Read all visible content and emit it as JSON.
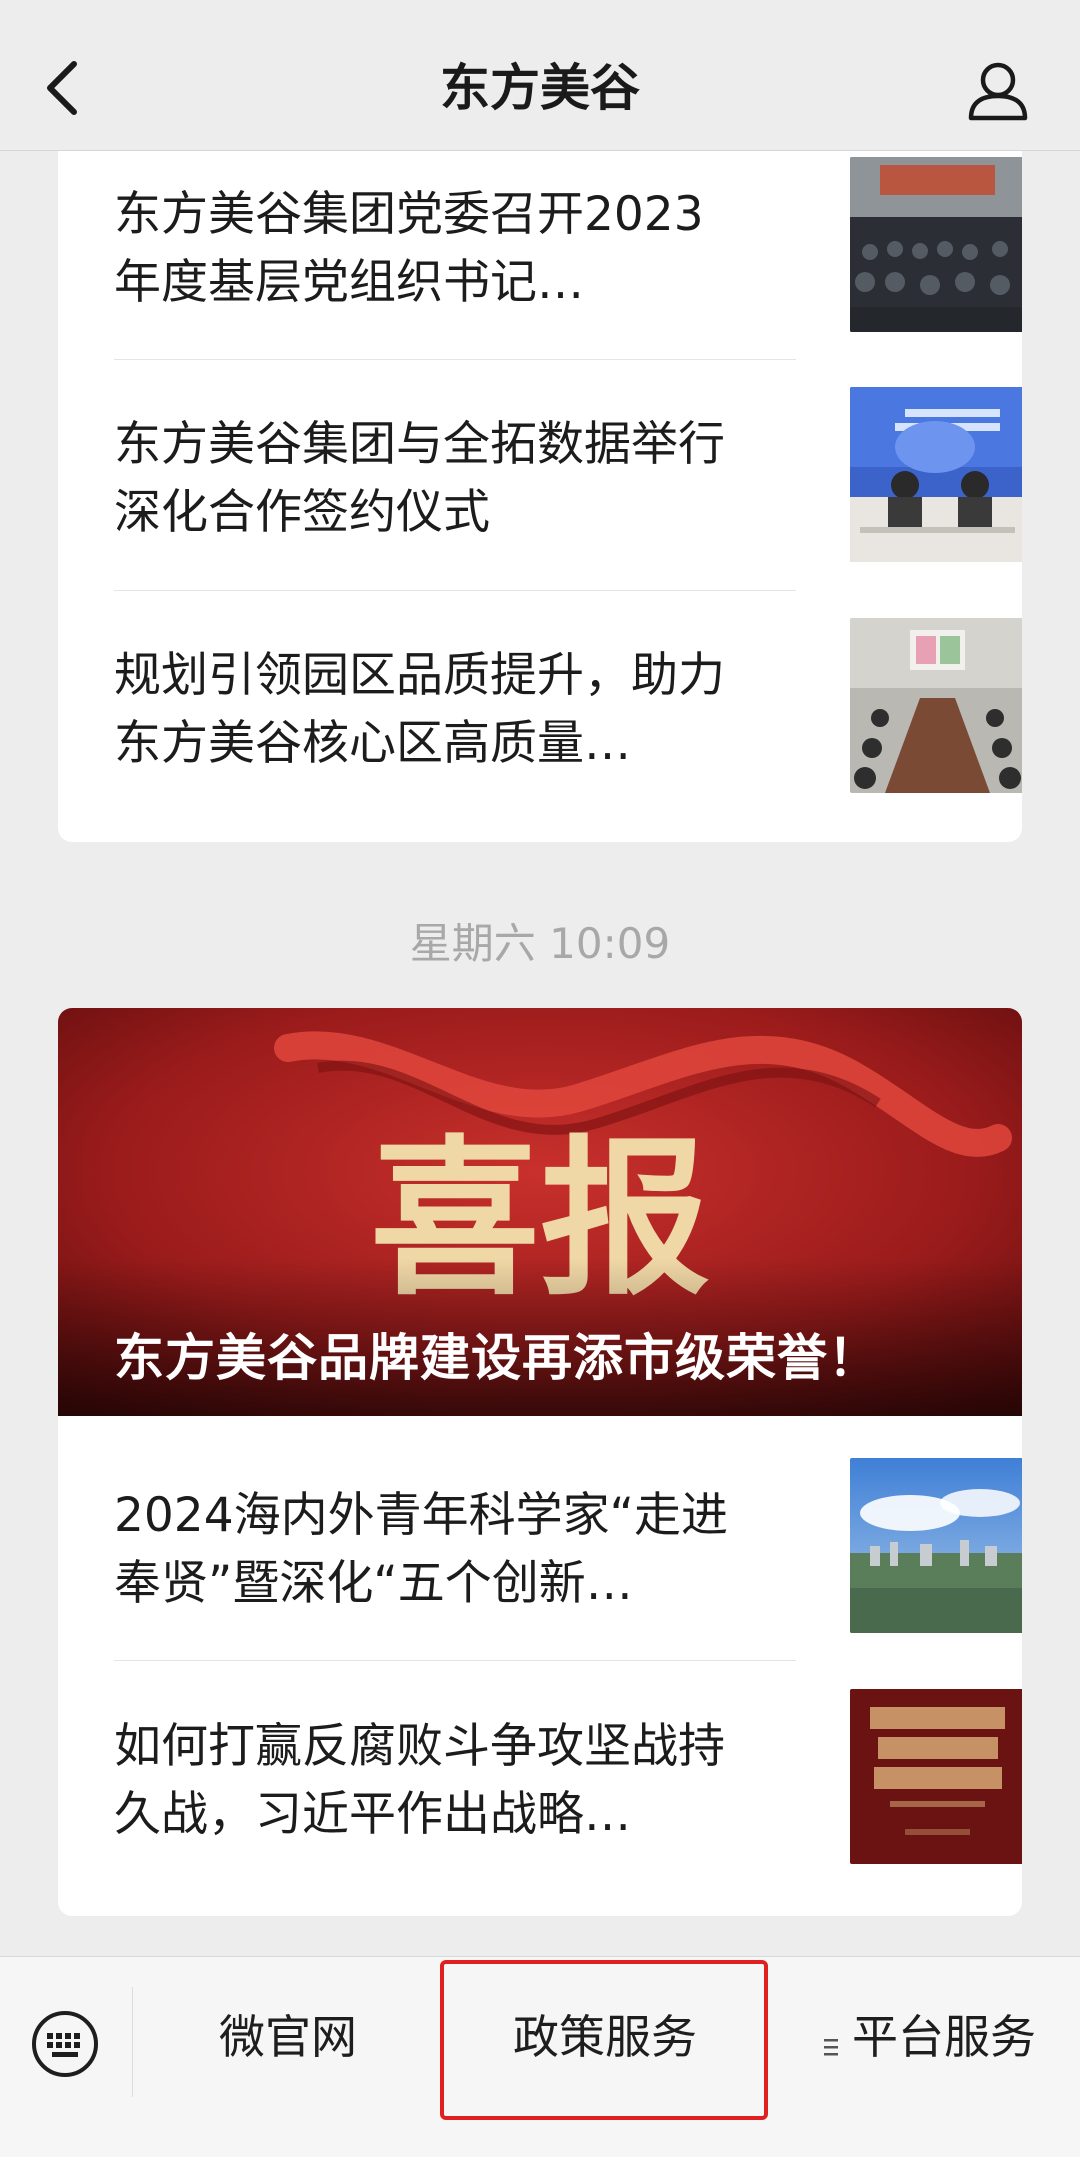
{
  "header": {
    "title": "东方美谷"
  },
  "feed_group_1": {
    "items": [
      {
        "title": "东方美谷集团党委召开2023年度基层党组织书记…"
      },
      {
        "title": "东方美谷集团与全拓数据举行深化合作签约仪式"
      },
      {
        "title": "规划引领园区品质提升，助力东方美谷核心区高质量…"
      }
    ]
  },
  "timestamp": "星期六 10:09",
  "feed_group_2": {
    "hero": {
      "art_text": "喜报",
      "headline": "东方美谷品牌建设再添市级荣誉！"
    },
    "items": [
      {
        "title": "2024海内外青年科学家“走进奉贤”暨深化“五个创新…"
      },
      {
        "title": "如何打赢反腐败斗争攻坚战持久战，习近平作出战略…"
      }
    ]
  },
  "bottom_menu": {
    "items": [
      {
        "label": "微官网"
      },
      {
        "label": "政策服务"
      },
      {
        "label": "平台服务"
      }
    ]
  },
  "colors": {
    "background": "#ededed",
    "card": "#ffffff",
    "highlight": "#e02020",
    "timestamp": "#a8a8a8"
  }
}
